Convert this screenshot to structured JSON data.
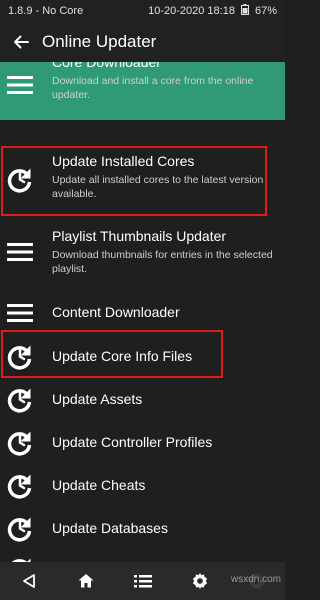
{
  "status": {
    "left": "1.8.9 - No Core",
    "datetime": "10-20-2020 18:18",
    "battery": "67%"
  },
  "header": {
    "title": "Online Updater"
  },
  "items": [
    {
      "label": "Core Downloader",
      "sub": "Download and install a core from the online updater.",
      "icon": "menu-icon"
    },
    {
      "label": "Update Installed Cores",
      "sub": "Update all installed cores to the latest version available.",
      "icon": "update-icon"
    },
    {
      "label": "Playlist Thumbnails Updater",
      "sub": "Download thumbnails for entries in the selected playlist.",
      "icon": "menu-icon"
    },
    {
      "label": "Content Downloader",
      "sub": "",
      "icon": "menu-icon"
    },
    {
      "label": "Update Core Info Files",
      "sub": "",
      "icon": "update-icon"
    },
    {
      "label": "Update Assets",
      "sub": "",
      "icon": "update-icon"
    },
    {
      "label": "Update Controller Profiles",
      "sub": "",
      "icon": "update-icon"
    },
    {
      "label": "Update Cheats",
      "sub": "",
      "icon": "update-icon"
    },
    {
      "label": "Update Databases",
      "sub": "",
      "icon": "update-icon"
    }
  ],
  "navbar": [
    "back-icon",
    "home-icon",
    "list-icon",
    "settings-icon",
    "quit-icon"
  ],
  "watermark": "wsxdn.com",
  "colors": {
    "highlight": "#2f9a74",
    "annotation": "#e01b1b",
    "background": "#1f1f1f"
  }
}
